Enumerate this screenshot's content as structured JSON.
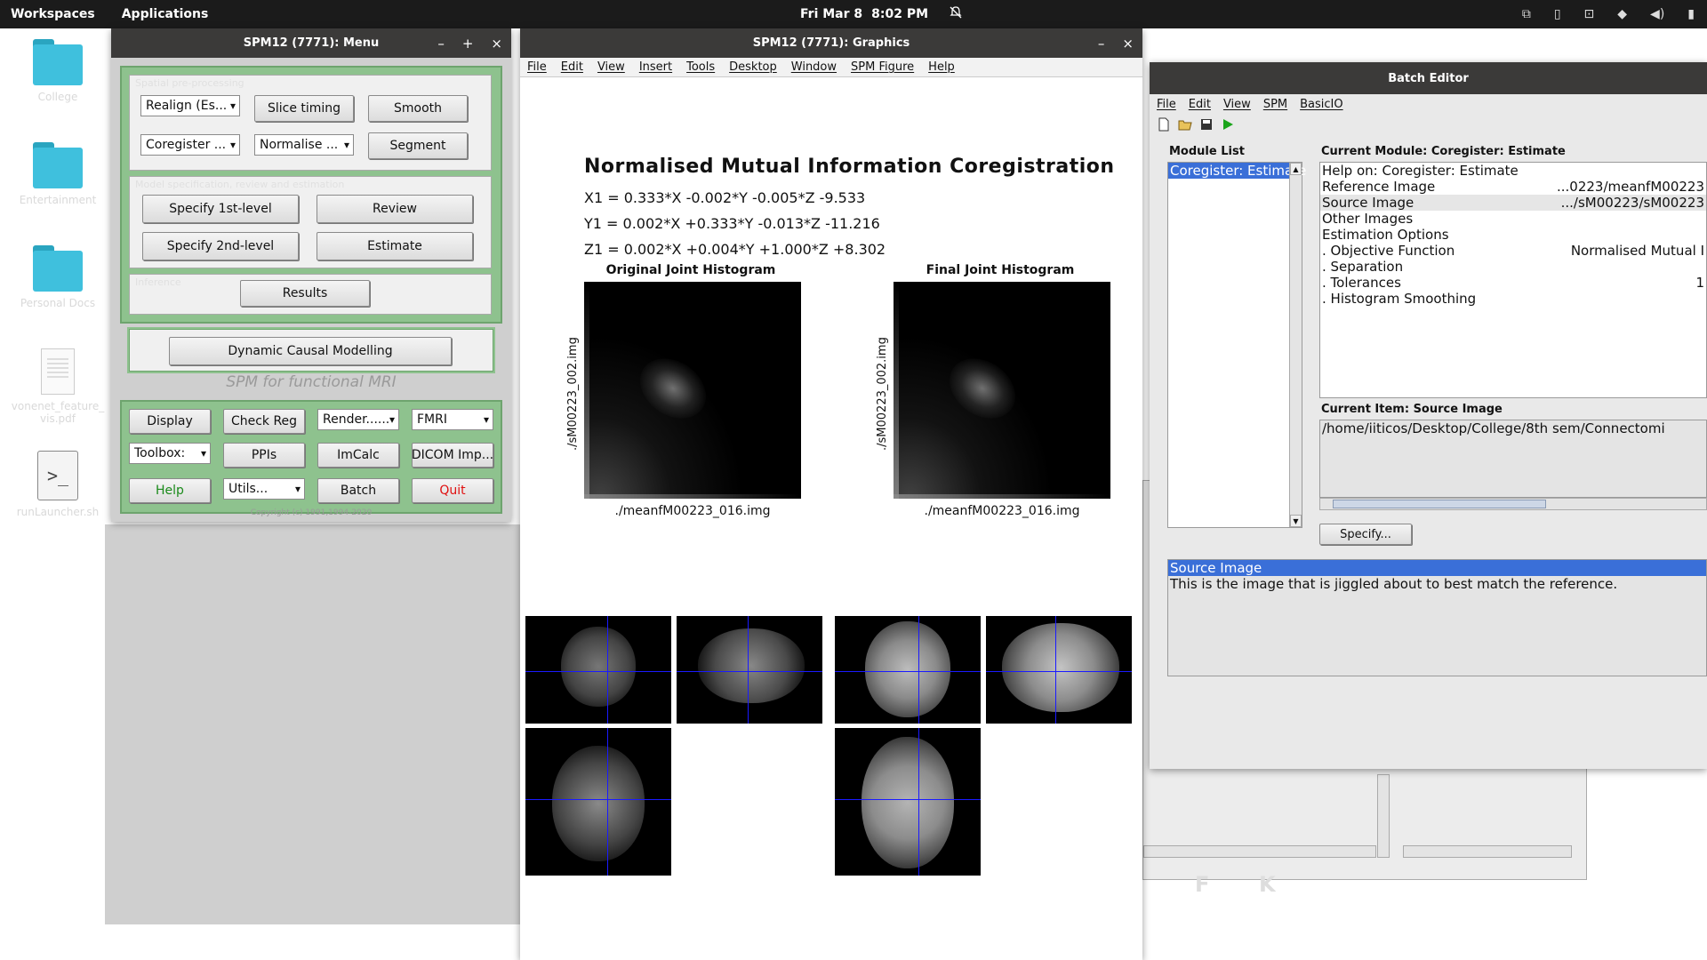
{
  "top_panel": {
    "workspaces": "Workspaces",
    "applications": "Applications",
    "date": "Fri Mar 8",
    "time": "8:02 PM"
  },
  "desktop_icons": [
    {
      "label": "College",
      "icon": "folder-icon"
    },
    {
      "label": "Entertainment",
      "icon": "folder-icon"
    },
    {
      "label": "Personal Docs",
      "icon": "folder-icon"
    },
    {
      "label": "vonenet_feature_vis.pdf",
      "icon": "pdf-icon"
    },
    {
      "label": "runLauncher.sh",
      "icon": "script-icon"
    }
  ],
  "spm_menu": {
    "title": "SPM12 (7771): Menu",
    "section1_label": "Spatial pre-processing",
    "section2_label": "Model specification, review and estimation",
    "section3_label": "Inference",
    "realign": "Realign (Es...",
    "slice_timing": "Slice timing",
    "smooth": "Smooth",
    "coregister": "Coregister ...",
    "normalise": "Normalise ...",
    "segment": "Segment",
    "specify_1st": "Specify 1st-level",
    "review": "Review",
    "specify_2nd": "Specify 2nd-level",
    "estimate": "Estimate",
    "results": "Results",
    "dcm": "Dynamic Causal Modelling",
    "fmri_label": "SPM for functional MRI",
    "display": "Display",
    "check_reg": "Check Reg",
    "render": "Render......",
    "modality": "FMRI",
    "toolbox": "Toolbox:",
    "ppis": "PPIs",
    "imcalc": "ImCalc",
    "dicom": "DICOM Imp...",
    "help": "Help",
    "utils": "Utils...",
    "batch": "Batch",
    "quit": "Quit",
    "copyright": "Copyright (c) 1991,1994-2020"
  },
  "graphics": {
    "title": "SPM12 (7771): Graphics",
    "menu": [
      "File",
      "Edit",
      "View",
      "Insert",
      "Tools",
      "Desktop",
      "Window",
      "SPM Figure",
      "Help"
    ],
    "heading": "Normalised Mutual Information Coregistration",
    "eq_x": "X1 = 0.333*X -0.002*Y -0.005*Z -9.533",
    "eq_y": "Y1 = 0.002*X +0.333*Y -0.013*Z -11.216",
    "eq_z": "Z1 = 0.002*X +0.004*Y +1.000*Z +8.302",
    "hist_original_title": "Original Joint Histogram",
    "hist_final_title": "Final Joint Histogram",
    "hist_ylabel": "./sM00223_002.img",
    "hist_xlabel": "./meanfM00223_016.img"
  },
  "batch_editor": {
    "title": "Batch Editor",
    "menu": [
      "File",
      "Edit",
      "View",
      "SPM",
      "BasicIO"
    ],
    "module_list_label": "Module List",
    "current_module_label": "Current Module: Coregister: Estimate",
    "module_items": [
      "Coregister: Estimate"
    ],
    "module_rows": [
      {
        "name": "Help on: Coregister: Estimate",
        "value": ""
      },
      {
        "name": "Reference Image",
        "value": "...0223/meanfM00223"
      },
      {
        "name": "Source Image",
        "value": ".../sM00223/sM00223"
      },
      {
        "name": "Other Images",
        "value": ""
      },
      {
        "name": "Estimation Options",
        "value": ""
      },
      {
        "name": ". Objective Function",
        "value": "Normalised Mutual I"
      },
      {
        "name": ". Separation",
        "value": ""
      },
      {
        "name": ". Tolerances",
        "value": "1"
      },
      {
        "name": ". Histogram Smoothing",
        "value": ""
      }
    ],
    "current_item_label": "Current Item: Source Image",
    "current_item_value": "/home/iiticos/Desktop/College/8th sem/Connectomi",
    "specify_button": "Specify...",
    "help_title": "Source Image",
    "help_text": "This is the image that is jiggled about to best match the reference."
  }
}
